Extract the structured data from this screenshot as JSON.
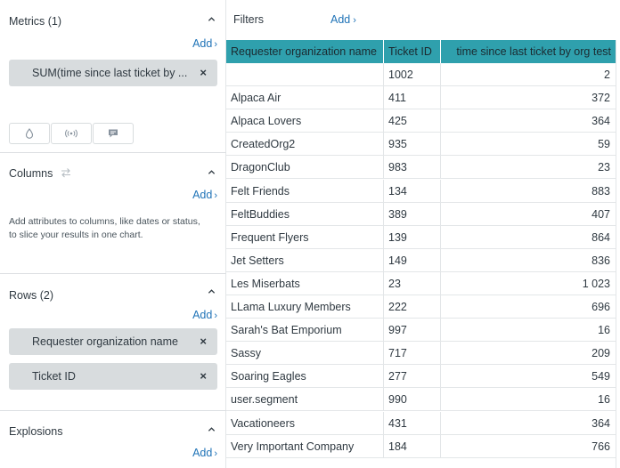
{
  "metrics": {
    "title": "Metrics (1)",
    "add_label": "Add",
    "items": [
      {
        "label": "SUM(time since last ticket by ..."
      }
    ]
  },
  "columns": {
    "title": "Columns",
    "add_label": "Add",
    "hint": "Add attributes to columns, like dates or status, to slice your results in one chart."
  },
  "rows": {
    "title": "Rows (2)",
    "add_label": "Add",
    "items": [
      {
        "label": "Requester organization name"
      },
      {
        "label": "Ticket ID"
      }
    ]
  },
  "explosions": {
    "title": "Explosions",
    "add_label": "Add"
  },
  "filters": {
    "title": "Filters",
    "add_label": "Add"
  },
  "icons": {
    "chevron": "chevron-up-icon",
    "swap": "swap-arrows-icon",
    "remove": "close-icon",
    "options": [
      "droplet-icon",
      "broadcast-icon",
      "comment-icon"
    ]
  },
  "colors": {
    "header_bg": "#2fa0ad",
    "link": "#1f73b7",
    "pill_bg": "#d8dcde"
  },
  "table": {
    "headers": [
      "Requester organization name",
      "Ticket ID",
      "time since last ticket by org test"
    ],
    "rows": [
      [
        "",
        "1002",
        "2"
      ],
      [
        "Alpaca Air",
        "411",
        "372"
      ],
      [
        "Alpaca Lovers",
        "425",
        "364"
      ],
      [
        "CreatedOrg2",
        "935",
        "59"
      ],
      [
        "DragonClub",
        "983",
        "23"
      ],
      [
        "Felt Friends",
        "134",
        "883"
      ],
      [
        "FeltBuddies",
        "389",
        "407"
      ],
      [
        "Frequent Flyers",
        "139",
        "864"
      ],
      [
        "Jet Setters",
        "149",
        "836"
      ],
      [
        "Les Miserbats",
        "23",
        "1 023"
      ],
      [
        "LLama Luxury Members",
        "222",
        "696"
      ],
      [
        "Sarah's Bat Emporium",
        "997",
        "16"
      ],
      [
        "Sassy",
        "717",
        "209"
      ],
      [
        "Soaring Eagles",
        "277",
        "549"
      ],
      [
        "user.segment",
        "990",
        "16"
      ],
      [
        "Vacationeers",
        "431",
        "364"
      ],
      [
        "Very Important Company",
        "184",
        "766"
      ]
    ]
  }
}
